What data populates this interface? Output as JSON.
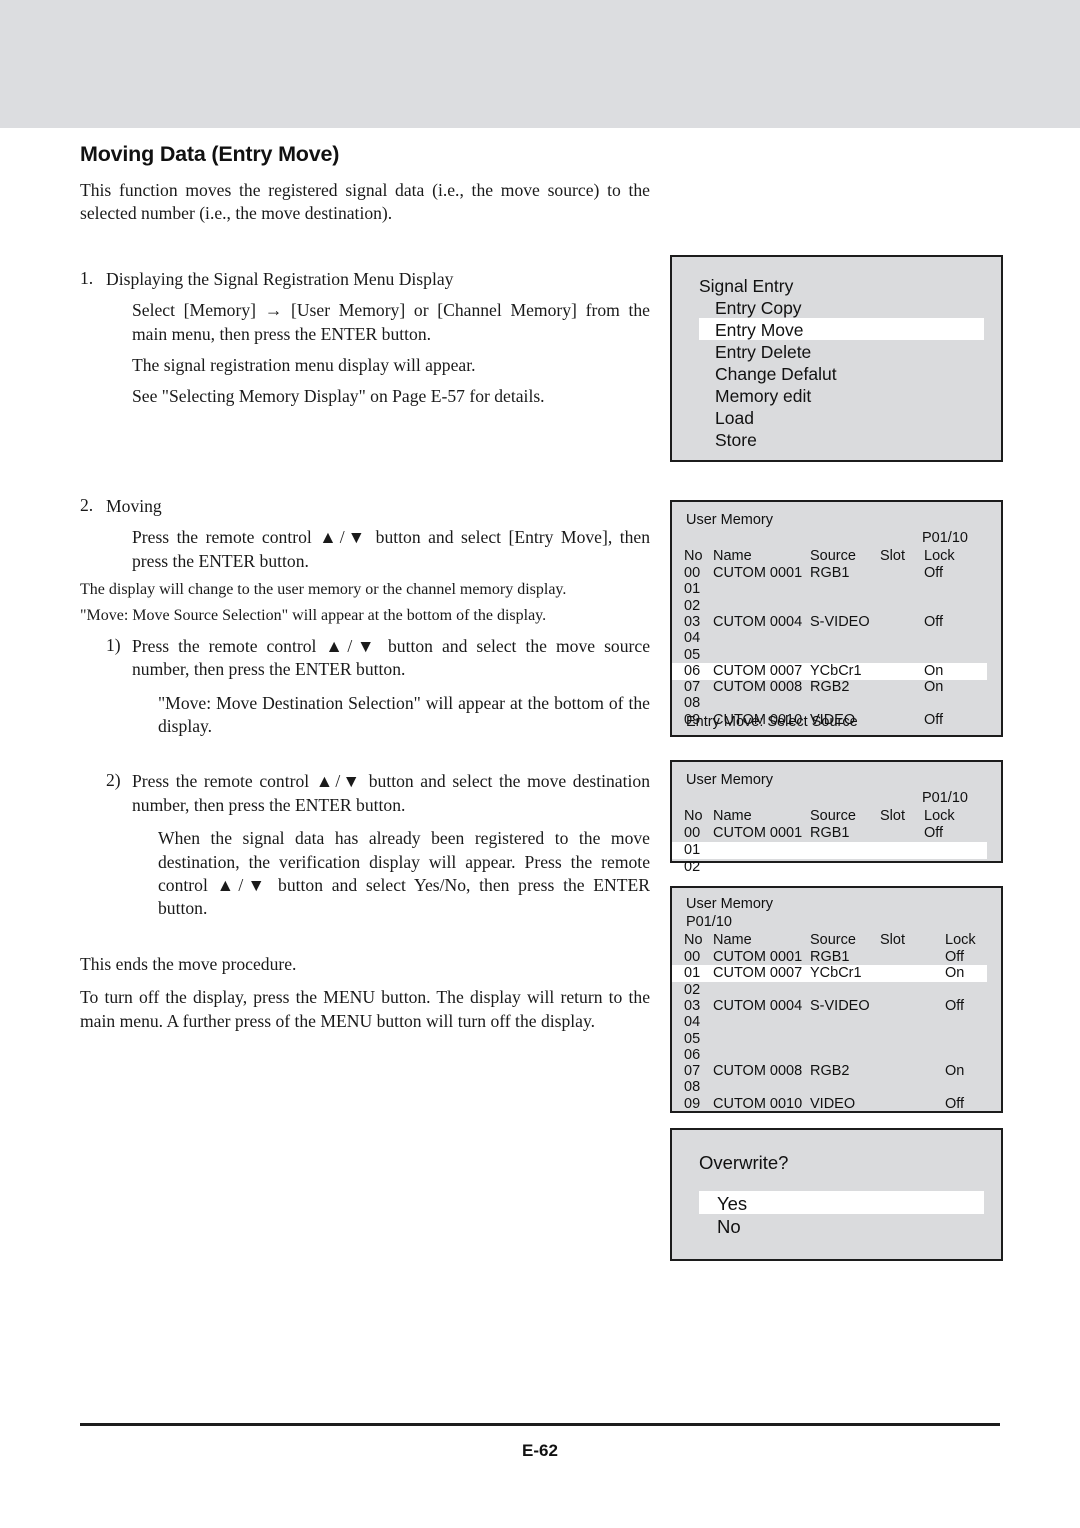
{
  "document": {
    "title": "Moving Data (Entry Move)",
    "intro": "This function moves the registered signal data (i.e., the move source) to the selected number (i.e., the move destination).",
    "step1": {
      "number": "1.",
      "title": "Displaying the Signal Registration Menu Display",
      "line1": "Select [Memory] → [User Memory] or [Channel Memory] from the main menu, then press the ENTER button.",
      "line2": "The signal registration menu display will appear.",
      "line3": "See \"Selecting Memory Display\" on Page E-57 for details."
    },
    "step2": {
      "number": "2.",
      "title": "Moving",
      "line1": "Press the remote control ▲/▼ button and select [Entry Move], then press the ENTER button.",
      "line2": "The display will change to the user memory or the channel memory display.",
      "line3": "\"Move: Move Source Selection\" will appear at the bottom of the display.",
      "sub1": {
        "number": "1)",
        "line1": "Press the remote control ▲/▼ button and select the move source number, then press the ENTER button.",
        "line2": "\"Move: Move Destination Selection\" will appear at the bottom of the display."
      },
      "sub2": {
        "number": "2)",
        "line1": "Press the remote control ▲/▼ button and select the move destination number, then press the ENTER button.",
        "line2": "When the signal data has already been registered to the move destination, the verification display will appear. Press the remote control ▲/▼ button and select Yes/No, then press the ENTER button."
      }
    },
    "closing1": "This ends the move procedure.",
    "closing2": "To turn off the display, press the MENU button. The display will return to the main menu. A further press of the MENU button will turn off the display.",
    "page_number": "E-62"
  },
  "osd": {
    "signal_entry": {
      "title": "Signal Entry",
      "items": [
        {
          "label": "Entry Copy",
          "selected": false
        },
        {
          "label": "Entry Move",
          "selected": true
        },
        {
          "label": "Entry Delete",
          "selected": false
        },
        {
          "label": "Change Defalut",
          "selected": false
        },
        {
          "label": "Memory edit",
          "selected": false
        },
        {
          "label": "Load",
          "selected": false
        },
        {
          "label": "Store",
          "selected": false
        }
      ]
    },
    "memory_source": {
      "title": "User Memory",
      "page_indicator": "P01/10",
      "columns": [
        "No",
        "Name",
        "Source",
        "Slot",
        "Lock"
      ],
      "rows": [
        {
          "no": "00",
          "name": "CUTOM 0001",
          "source": "RGB1",
          "slot": "",
          "lock": "Off",
          "selected": false
        },
        {
          "no": "01",
          "name": "",
          "source": "",
          "slot": "",
          "lock": "",
          "selected": false
        },
        {
          "no": "02",
          "name": "",
          "source": "",
          "slot": "",
          "lock": "",
          "selected": false
        },
        {
          "no": "03",
          "name": "CUTOM 0004",
          "source": "S-VIDEO",
          "slot": "",
          "lock": "Off",
          "selected": false
        },
        {
          "no": "04",
          "name": "",
          "source": "",
          "slot": "",
          "lock": "",
          "selected": false
        },
        {
          "no": "05",
          "name": "",
          "source": "",
          "slot": "",
          "lock": "",
          "selected": false
        },
        {
          "no": "06",
          "name": "CUTOM 0007",
          "source": "YCbCr1",
          "slot": "",
          "lock": "On",
          "selected": true
        },
        {
          "no": "07",
          "name": "CUTOM 0008",
          "source": "RGB2",
          "slot": "",
          "lock": "On",
          "selected": false
        },
        {
          "no": "08",
          "name": "",
          "source": "",
          "slot": "",
          "lock": "",
          "selected": false
        },
        {
          "no": "09",
          "name": "CUTOM 0010",
          "source": "VIDEO",
          "slot": "",
          "lock": "Off",
          "selected": false
        }
      ],
      "footer": "Entry Move: Select Source"
    },
    "memory_dest": {
      "title": "User Memory",
      "page_indicator": "P01/10",
      "columns": [
        "No",
        "Name",
        "Source",
        "Slot",
        "Lock"
      ],
      "rows": [
        {
          "no": "00",
          "name": "CUTOM 0001",
          "source": "RGB1",
          "slot": "",
          "lock": "Off",
          "selected": false
        },
        {
          "no": "01",
          "name": "",
          "source": "",
          "slot": "",
          "lock": "",
          "selected": true
        },
        {
          "no": "02",
          "name": "",
          "source": "",
          "slot": "",
          "lock": "",
          "selected": false
        }
      ]
    },
    "memory_result": {
      "title": "User Memory",
      "page_indicator": "P01/10",
      "columns": [
        "No",
        "Name",
        "Source",
        "Slot",
        "Lock"
      ],
      "rows": [
        {
          "no": "00",
          "name": "CUTOM 0001",
          "source": "RGB1",
          "slot": "",
          "lock": "Off",
          "selected": false
        },
        {
          "no": "01",
          "name": "CUTOM 0007",
          "source": "YCbCr1",
          "slot": "",
          "lock": "On",
          "selected": true
        },
        {
          "no": "02",
          "name": "",
          "source": "",
          "slot": "",
          "lock": "",
          "selected": false
        },
        {
          "no": "03",
          "name": "CUTOM 0004",
          "source": "S-VIDEO",
          "slot": "",
          "lock": "Off",
          "selected": false
        },
        {
          "no": "04",
          "name": "",
          "source": "",
          "slot": "",
          "lock": "",
          "selected": false
        },
        {
          "no": "05",
          "name": "",
          "source": "",
          "slot": "",
          "lock": "",
          "selected": false
        },
        {
          "no": "06",
          "name": "",
          "source": "",
          "slot": "",
          "lock": "",
          "selected": false
        },
        {
          "no": "07",
          "name": "CUTOM 0008",
          "source": "RGB2",
          "slot": "",
          "lock": "On",
          "selected": false
        },
        {
          "no": "08",
          "name": "",
          "source": "",
          "slot": "",
          "lock": "",
          "selected": false
        },
        {
          "no": "09",
          "name": "CUTOM 0010",
          "source": "VIDEO",
          "slot": "",
          "lock": "Off",
          "selected": false
        }
      ]
    },
    "overwrite": {
      "title": "Overwrite?",
      "options": [
        {
          "label": "Yes",
          "selected": true
        },
        {
          "label": "No",
          "selected": false
        }
      ]
    }
  }
}
